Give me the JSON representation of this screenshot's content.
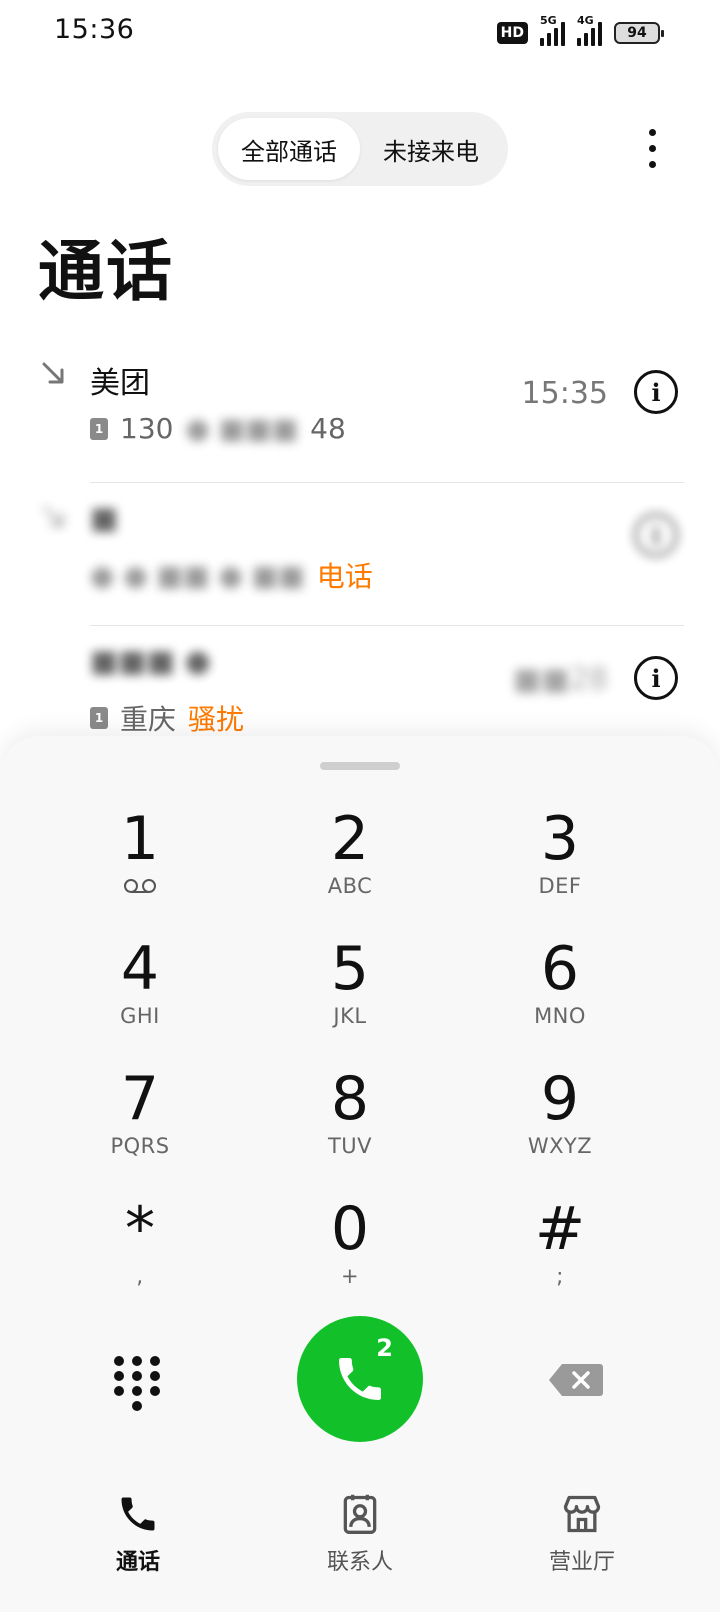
{
  "status_bar": {
    "time": "15:36",
    "hd": "HD",
    "network_a": "5G",
    "network_b": "4G",
    "battery": "94"
  },
  "header": {
    "tabs": [
      {
        "label": "全部通话",
        "active": true
      },
      {
        "label": "未接来电",
        "active": false
      }
    ],
    "title": "通话"
  },
  "calls": [
    {
      "name": "美团",
      "number": "130",
      "number_tail": "48",
      "time": "15:35",
      "info_icon": "info-icon"
    },
    {
      "name": "",
      "number": "",
      "tag": "电话",
      "time": "",
      "info_icon": "info-icon"
    },
    {
      "name": "",
      "number": "",
      "location": "重庆",
      "tag": "骚扰",
      "time": "",
      "info_icon": "info-icon"
    }
  ],
  "dialer": {
    "keys": [
      {
        "digit": "1",
        "letters": ""
      },
      {
        "digit": "2",
        "letters": "ABC"
      },
      {
        "digit": "3",
        "letters": "DEF"
      },
      {
        "digit": "4",
        "letters": "GHI"
      },
      {
        "digit": "5",
        "letters": "JKL"
      },
      {
        "digit": "6",
        "letters": "MNO"
      },
      {
        "digit": "7",
        "letters": "PQRS"
      },
      {
        "digit": "8",
        "letters": "TUV"
      },
      {
        "digit": "9",
        "letters": "WXYZ"
      },
      {
        "digit": "*",
        "letters": ","
      },
      {
        "digit": "0",
        "letters": "+"
      },
      {
        "digit": "#",
        "letters": ";"
      }
    ],
    "call_sim": "2"
  },
  "bottom_nav": [
    {
      "label": "通话",
      "icon": "phone-icon",
      "active": true
    },
    {
      "label": "联系人",
      "icon": "contacts-icon",
      "active": false
    },
    {
      "label": "营业厅",
      "icon": "store-icon",
      "active": false
    }
  ],
  "colors": {
    "call_green": "#12c12a",
    "tag_orange": "#ff7a00"
  }
}
